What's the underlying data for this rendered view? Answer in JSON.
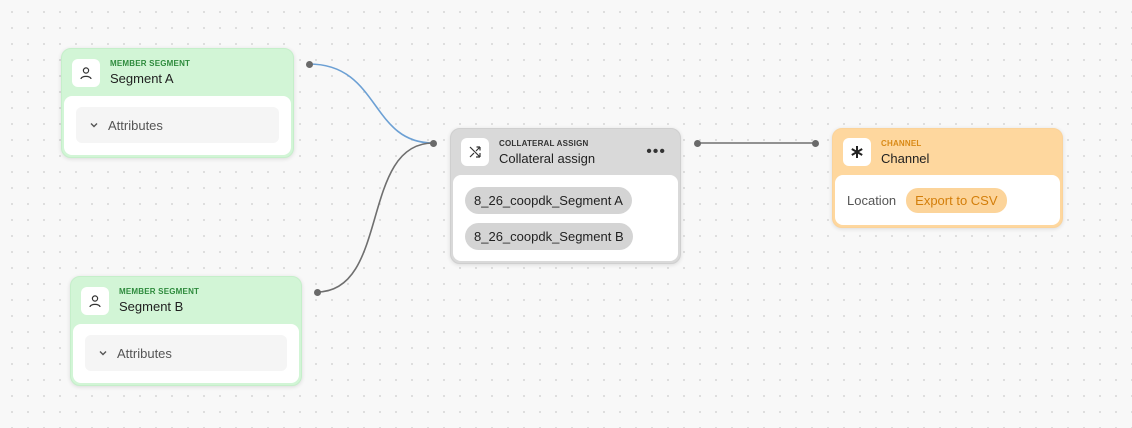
{
  "nodes": {
    "segment_a": {
      "type_label": "MEMBER SEGMENT",
      "title": "Segment A",
      "attributes_label": "Attributes",
      "icon": "user-icon"
    },
    "segment_b": {
      "type_label": "MEMBER SEGMENT",
      "title": "Segment B",
      "attributes_label": "Attributes",
      "icon": "user-icon"
    },
    "collateral": {
      "type_label": "COLLATERAL ASSIGN",
      "title": "Collateral assign",
      "icon": "shuffle-icon",
      "menu_label": "•••",
      "items": [
        "8_26_coopdk_Segment A",
        "8_26_coopdk_Segment B"
      ]
    },
    "channel": {
      "type_label": "CHANNEL",
      "title": "Channel",
      "icon": "asterisk-icon",
      "location_label": "Location",
      "location_value": "Export to CSV"
    }
  },
  "colors": {
    "segment_bg": "#d2f5d6",
    "segment_type_text": "#2e8b3d",
    "collateral_bg": "#d9d9d9",
    "channel_bg": "#fed79e",
    "channel_accent": "#d37e0a",
    "edge_highlight": "#6ca0d4",
    "edge_default": "#6f6f6f"
  }
}
